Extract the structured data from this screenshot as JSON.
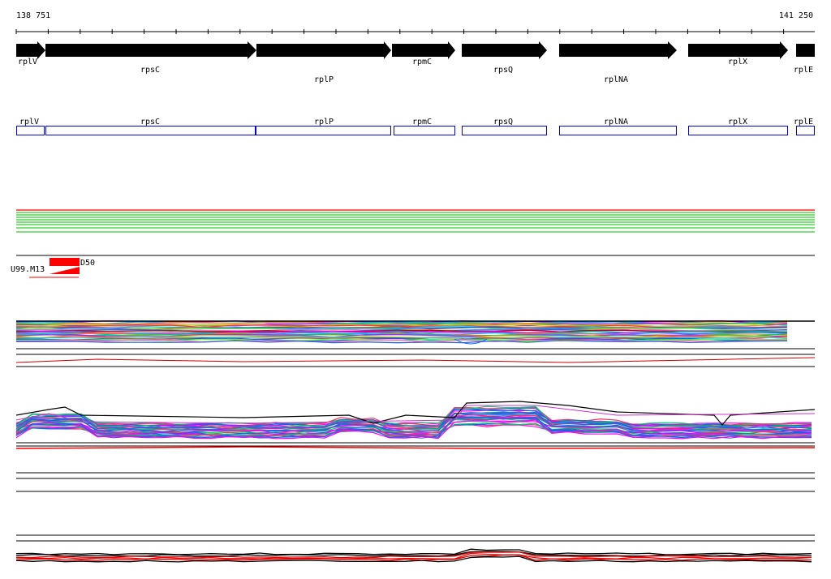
{
  "ruler": {
    "start_label": "138 751",
    "end_label": "141 250"
  },
  "genes": [
    {
      "name": "rplV"
    },
    {
      "name": "rpsC"
    },
    {
      "name": "rplP"
    },
    {
      "name": "rpmC"
    },
    {
      "name": "rpsQ"
    },
    {
      "name": "rplNA"
    },
    {
      "name": "rplX"
    },
    {
      "name": "rplE"
    }
  ],
  "feature_track": {
    "label_left": "U99.M13",
    "label_right": "D50"
  },
  "colors": {
    "gene_arrow": "#000000",
    "gene_box": "#0000cc",
    "green": "#33cc33",
    "red": "#ff0000",
    "line": "#000000"
  }
}
